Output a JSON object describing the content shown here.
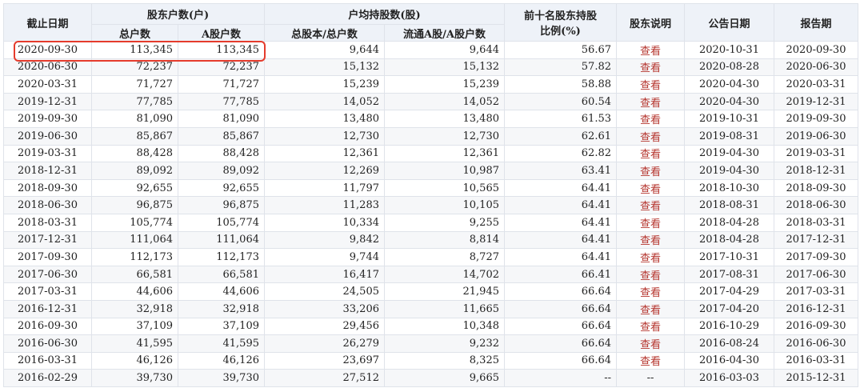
{
  "headers": {
    "end_date": "截止日期",
    "holders_group": "股东户数(户)",
    "total_holders": "总户数",
    "a_holders": "A股户数",
    "avg_group": "户均持股数(股)",
    "avg_total": "总股本/总户数",
    "avg_float": "流通A股/A股户数",
    "top10_line1": "前十名股东持股",
    "top10_line2": "比例(%)",
    "note": "股东说明",
    "announce": "公告日期",
    "report": "报告期"
  },
  "view_label": "查看",
  "highlight_color": "#e53b2c",
  "rows": [
    {
      "date": "2020-09-30",
      "total": "113,345",
      "a": "113,345",
      "avg_total": "9,644",
      "avg_float": "9,644",
      "top10": "56.67",
      "note": "查看",
      "announce": "2020-10-31",
      "report": "2020-09-30"
    },
    {
      "date": "2020-06-30",
      "total": "72,237",
      "a": "72,237",
      "avg_total": "15,132",
      "avg_float": "15,132",
      "top10": "57.82",
      "note": "查看",
      "announce": "2020-08-28",
      "report": "2020-06-30"
    },
    {
      "date": "2020-03-31",
      "total": "71,727",
      "a": "71,727",
      "avg_total": "15,239",
      "avg_float": "15,239",
      "top10": "58.88",
      "note": "查看",
      "announce": "2020-04-30",
      "report": "2020-03-31"
    },
    {
      "date": "2019-12-31",
      "total": "77,785",
      "a": "77,785",
      "avg_total": "14,052",
      "avg_float": "14,052",
      "top10": "60.54",
      "note": "查看",
      "announce": "2020-04-30",
      "report": "2019-12-31"
    },
    {
      "date": "2019-09-30",
      "total": "81,090",
      "a": "81,090",
      "avg_total": "13,480",
      "avg_float": "13,480",
      "top10": "61.53",
      "note": "查看",
      "announce": "2019-10-31",
      "report": "2019-09-30"
    },
    {
      "date": "2019-06-30",
      "total": "85,867",
      "a": "85,867",
      "avg_total": "12,730",
      "avg_float": "12,730",
      "top10": "62.61",
      "note": "查看",
      "announce": "2019-08-31",
      "report": "2019-06-30"
    },
    {
      "date": "2019-03-31",
      "total": "88,428",
      "a": "88,428",
      "avg_total": "12,361",
      "avg_float": "12,361",
      "top10": "62.82",
      "note": "查看",
      "announce": "2019-04-30",
      "report": "2019-03-31"
    },
    {
      "date": "2018-12-31",
      "total": "89,092",
      "a": "89,092",
      "avg_total": "12,269",
      "avg_float": "10,987",
      "top10": "63.41",
      "note": "查看",
      "announce": "2019-04-30",
      "report": "2018-12-31"
    },
    {
      "date": "2018-09-30",
      "total": "92,655",
      "a": "92,655",
      "avg_total": "11,797",
      "avg_float": "10,565",
      "top10": "64.41",
      "note": "查看",
      "announce": "2018-10-30",
      "report": "2018-09-30"
    },
    {
      "date": "2018-06-30",
      "total": "96,875",
      "a": "96,875",
      "avg_total": "11,283",
      "avg_float": "10,105",
      "top10": "64.41",
      "note": "查看",
      "announce": "2018-08-31",
      "report": "2018-06-30"
    },
    {
      "date": "2018-03-31",
      "total": "105,774",
      "a": "105,774",
      "avg_total": "10,334",
      "avg_float": "9,255",
      "top10": "64.41",
      "note": "查看",
      "announce": "2018-04-28",
      "report": "2018-03-31"
    },
    {
      "date": "2017-12-31",
      "total": "111,064",
      "a": "111,064",
      "avg_total": "9,842",
      "avg_float": "8,814",
      "top10": "64.41",
      "note": "查看",
      "announce": "2018-04-28",
      "report": "2017-12-31"
    },
    {
      "date": "2017-09-30",
      "total": "112,173",
      "a": "112,173",
      "avg_total": "9,744",
      "avg_float": "8,727",
      "top10": "64.41",
      "note": "查看",
      "announce": "2017-10-31",
      "report": "2017-09-30"
    },
    {
      "date": "2017-06-30",
      "total": "66,581",
      "a": "66,581",
      "avg_total": "16,417",
      "avg_float": "14,702",
      "top10": "66.41",
      "note": "查看",
      "announce": "2017-08-31",
      "report": "2017-06-30"
    },
    {
      "date": "2017-03-31",
      "total": "44,606",
      "a": "44,606",
      "avg_total": "24,505",
      "avg_float": "21,945",
      "top10": "66.64",
      "note": "查看",
      "announce": "2017-04-29",
      "report": "2017-03-31"
    },
    {
      "date": "2016-12-31",
      "total": "32,918",
      "a": "32,918",
      "avg_total": "33,206",
      "avg_float": "11,665",
      "top10": "66.64",
      "note": "查看",
      "announce": "2017-04-20",
      "report": "2016-12-31"
    },
    {
      "date": "2016-09-30",
      "total": "37,109",
      "a": "37,109",
      "avg_total": "29,456",
      "avg_float": "10,348",
      "top10": "66.64",
      "note": "查看",
      "announce": "2016-10-29",
      "report": "2016-09-30"
    },
    {
      "date": "2016-06-30",
      "total": "41,595",
      "a": "41,595",
      "avg_total": "26,279",
      "avg_float": "9,232",
      "top10": "66.64",
      "note": "查看",
      "announce": "2016-08-24",
      "report": "2016-06-30"
    },
    {
      "date": "2016-03-31",
      "total": "46,126",
      "a": "46,126",
      "avg_total": "23,697",
      "avg_float": "8,325",
      "top10": "66.64",
      "note": "查看",
      "announce": "2016-04-30",
      "report": "2016-03-31"
    },
    {
      "date": "2016-02-29",
      "total": "39,730",
      "a": "39,730",
      "avg_total": "27,512",
      "avg_float": "9,665",
      "top10": "--",
      "note": "--",
      "announce": "2016-03-03",
      "report": "2015-12-31"
    }
  ]
}
